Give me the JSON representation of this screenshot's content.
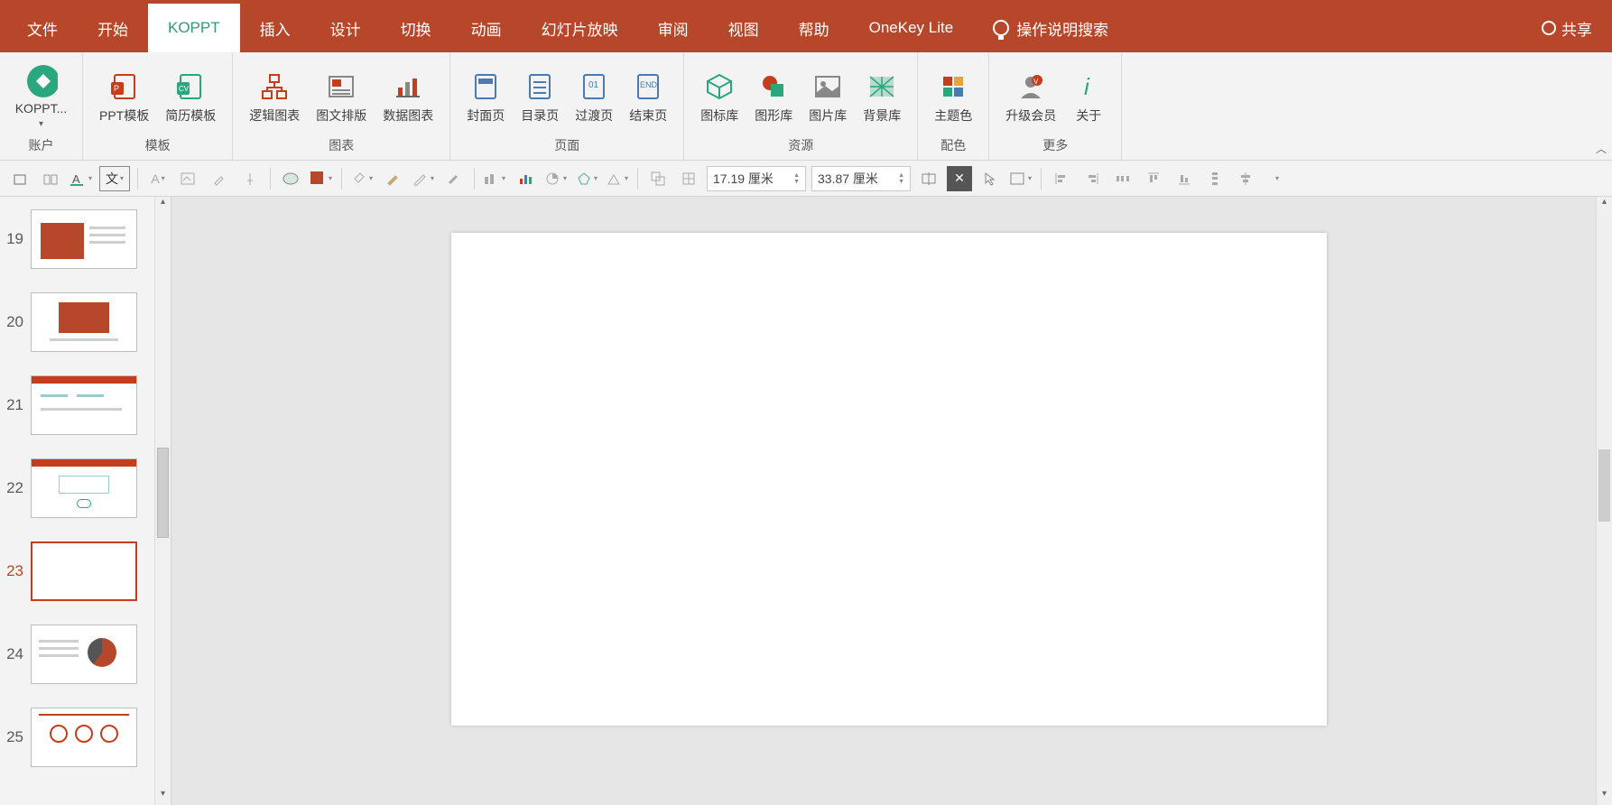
{
  "tabs": {
    "file": "文件",
    "home": "开始",
    "koppt": "KOPPT",
    "insert": "插入",
    "design": "设计",
    "transition": "切换",
    "animation": "动画",
    "slideshow": "幻灯片放映",
    "review": "审阅",
    "view": "视图",
    "help": "帮助",
    "onekey": "OneKey Lite",
    "tell_me": "操作说明搜索",
    "share": "共享"
  },
  "ribbon": {
    "account": {
      "btn": "KOPPT...",
      "label": "账户"
    },
    "templates": {
      "ppt": "PPT模板",
      "resume": "简历模板",
      "label": "模板"
    },
    "charts": {
      "logic": "逻辑图表",
      "imgtxt": "图文排版",
      "data": "数据图表",
      "label": "图表"
    },
    "pages": {
      "cover": "封面页",
      "toc": "目录页",
      "transition": "过渡页",
      "end": "结束页",
      "label": "页面"
    },
    "resources": {
      "icons": "图标库",
      "shapes": "图形库",
      "images": "图片库",
      "bg": "背景库",
      "label": "资源"
    },
    "color": {
      "theme": "主题色",
      "label": "配色"
    },
    "more": {
      "upgrade": "升级会员",
      "about": "关于",
      "label": "更多"
    }
  },
  "qat": {
    "width": "17.19 厘米",
    "height": "33.87 厘米"
  },
  "slides": [
    {
      "num": 19,
      "sel": false,
      "kind": "red-block"
    },
    {
      "num": 20,
      "sel": false,
      "kind": "red-center"
    },
    {
      "num": 21,
      "sel": false,
      "kind": "app-1"
    },
    {
      "num": 22,
      "sel": false,
      "kind": "app-2"
    },
    {
      "num": 23,
      "sel": true,
      "kind": "blank"
    },
    {
      "num": 24,
      "sel": false,
      "kind": "pie"
    },
    {
      "num": 25,
      "sel": false,
      "kind": "circles"
    }
  ]
}
